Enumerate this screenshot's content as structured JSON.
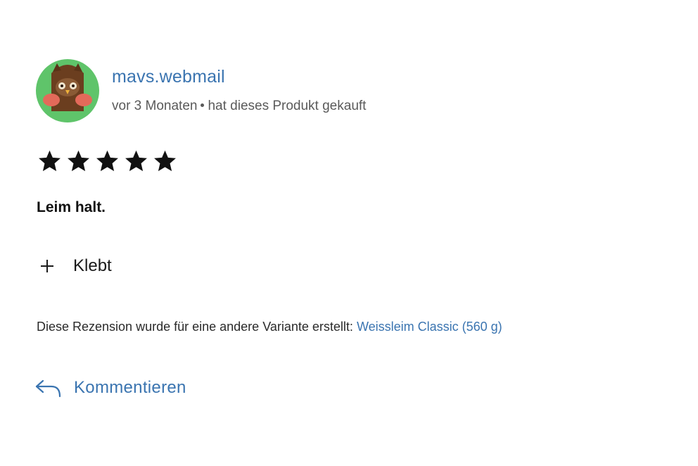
{
  "review": {
    "author": {
      "name": "mavs.webmail",
      "avatar_icon": "owl-avatar-icon",
      "avatar_bg": "#5fc46a"
    },
    "meta": {
      "time": "vor 3 Monaten",
      "purchase_note": "hat dieses Produkt gekauft"
    },
    "rating": {
      "value": 5,
      "max": 5,
      "star_icon": "star-filled-icon"
    },
    "title": "Leim halt.",
    "pros": [
      {
        "icon": "plus-icon",
        "text": "Klebt"
      }
    ],
    "variant": {
      "prefix": "Diese Rezension wurde für eine andere Variante erstellt:",
      "link": "Weissleim Classic (560 g)"
    },
    "comment": {
      "icon": "reply-arrow-icon",
      "label": "Kommentieren"
    },
    "colors": {
      "link": "#3a74b0",
      "text": "#1a1a1a",
      "muted": "#5a5a5a"
    }
  }
}
